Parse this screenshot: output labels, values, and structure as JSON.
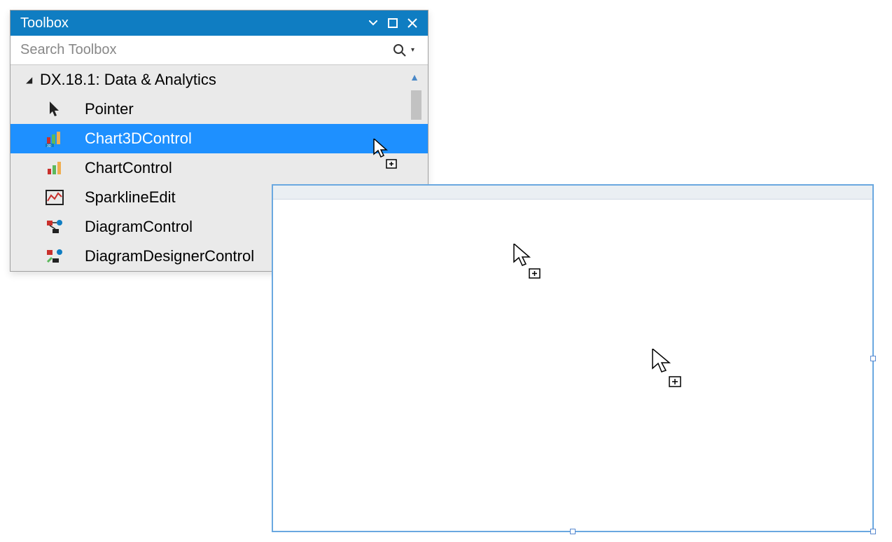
{
  "toolbox": {
    "title": "Toolbox",
    "search_placeholder": "Search Toolbox",
    "category": {
      "label": "DX.18.1: Data & Analytics",
      "expanded": true
    },
    "items": [
      {
        "name": "Pointer",
        "icon": "pointer",
        "selected": false
      },
      {
        "name": "Chart3DControl",
        "icon": "chart3d",
        "selected": true
      },
      {
        "name": "ChartControl",
        "icon": "chart",
        "selected": false
      },
      {
        "name": "SparklineEdit",
        "icon": "sparkline",
        "selected": false
      },
      {
        "name": "DiagramControl",
        "icon": "diagram",
        "selected": false
      },
      {
        "name": "DiagramDesignerControl",
        "icon": "diagramdesigner",
        "selected": false
      }
    ]
  },
  "colors": {
    "titlebar": "#0f7dc2",
    "selection": "#1e90ff"
  }
}
